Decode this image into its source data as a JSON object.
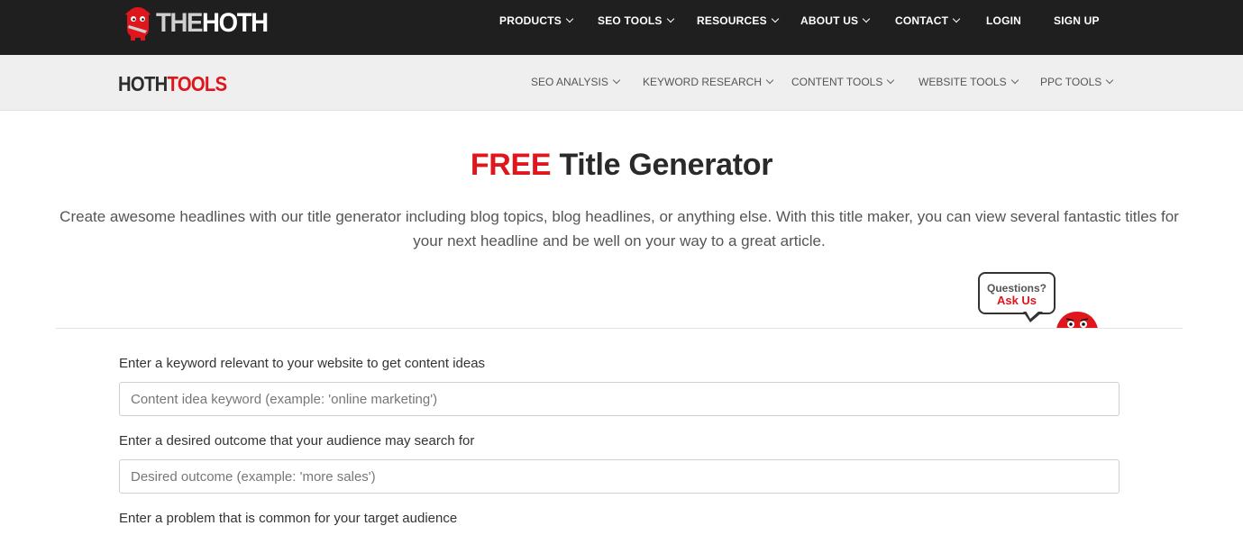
{
  "header": {
    "logo": {
      "part1": "THE",
      "part2": "HOTH"
    },
    "nav": [
      {
        "label": "PRODUCTS",
        "dropdown": true
      },
      {
        "label": "SEO TOOLS",
        "dropdown": true
      },
      {
        "label": "RESOURCES",
        "dropdown": true
      },
      {
        "label": "ABOUT US",
        "dropdown": true
      },
      {
        "label": "CONTACT",
        "dropdown": true
      },
      {
        "label": "LOGIN",
        "dropdown": false
      },
      {
        "label": "SIGN UP",
        "dropdown": false
      }
    ]
  },
  "subheader": {
    "logo": {
      "part1": "HOTH",
      "part2": "TOOLS"
    },
    "nav": [
      {
        "label": "SEO ANALYSIS"
      },
      {
        "label": "KEYWORD RESEARCH"
      },
      {
        "label": "CONTENT TOOLS"
      },
      {
        "label": "WEBSITE TOOLS"
      },
      {
        "label": "PPC TOOLS"
      }
    ]
  },
  "hero": {
    "title_highlight": "FREE",
    "title_rest": "Title Generator",
    "description": "Create awesome headlines with our title generator including blog topics, blog headlines, or anything else. With this title maker, you can view several fantastic titles for your next headline and be well on your way to a great article."
  },
  "help_widget": {
    "line1": "Questions?",
    "line2": "Ask Us"
  },
  "form": {
    "keyword": {
      "label": "Enter a keyword relevant to your website to get content ideas",
      "placeholder": "Content idea keyword (example: 'online marketing')",
      "value": ""
    },
    "outcome": {
      "label": "Enter a desired outcome that your audience may search for",
      "placeholder": "Desired outcome (example: 'more sales')",
      "value": ""
    },
    "problem": {
      "label": "Enter a problem that is common for your target audience"
    }
  },
  "colors": {
    "brand_red": "#e0161d",
    "topbar_bg": "#1f1f1f",
    "subbar_bg": "#efefef"
  }
}
